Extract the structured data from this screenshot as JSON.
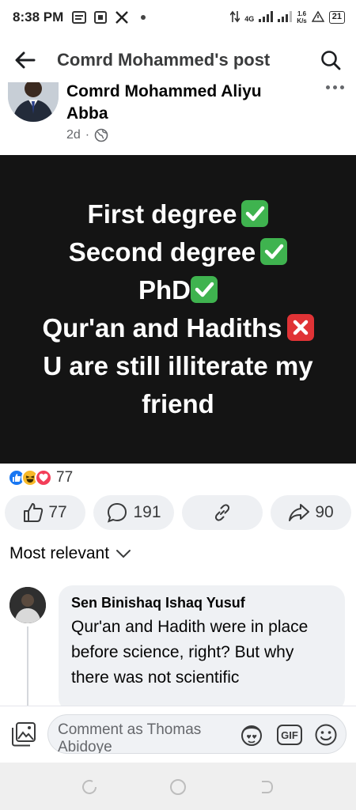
{
  "status_bar": {
    "time": "8:38 PM",
    "network": "4G",
    "speed_value": "1.6",
    "speed_unit": "K/s",
    "battery": "21"
  },
  "header": {
    "title": "Comrd Mohammed's post"
  },
  "post": {
    "author": "Comrd Mohammed Aliyu Abba",
    "time": "2d",
    "separator": "·",
    "lines": [
      "First degree",
      "Second degree",
      "PhD",
      "Qur'an and Hadiths",
      "U are still illiterate my friend"
    ],
    "background_color": "#141414"
  },
  "reactions": {
    "count": "77",
    "types": [
      "like",
      "haha",
      "love"
    ]
  },
  "actions": {
    "like_count": "77",
    "comment_count": "191",
    "share_count": "90"
  },
  "comments": {
    "sort_label": "Most relevant",
    "items": [
      {
        "author": "Sen Binishaq Ishaq Yusuf",
        "text": "Qur'an and Hadith were in place before science, right? But why there was not scientific"
      }
    ]
  },
  "composer": {
    "placeholder": "Comment as Thomas Abidoye",
    "gif_label": "GIF"
  },
  "colors": {
    "facebook_blue": "#1877f2",
    "pill_bg": "#eef0f3",
    "check_green": "#3fb34f",
    "cross_red": "#e03336"
  }
}
